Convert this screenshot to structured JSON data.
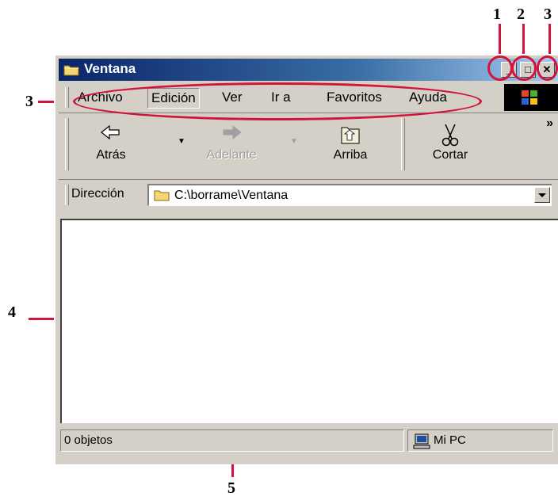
{
  "annotations": {
    "top_numbers": [
      "1",
      "2",
      "3"
    ],
    "menu_number": "3",
    "content_number": "4",
    "status_number": "5"
  },
  "window": {
    "title": "Ventana",
    "controls": {
      "minimize": "_",
      "maximize": "□",
      "close": "✕"
    }
  },
  "menubar": {
    "items": [
      "Archivo",
      "Edición",
      "Ver",
      "Ir a",
      "Favoritos",
      "Ayuda"
    ],
    "selected": "Edición"
  },
  "toolbar": {
    "back": "Atrás",
    "forward": "Adelante",
    "up": "Arriba",
    "cut": "Cortar",
    "overflow": "»"
  },
  "address": {
    "label": "Dirección",
    "value": "C:\\borrame\\Ventana"
  },
  "status": {
    "objects": "0 objetos",
    "location": "Mi PC"
  },
  "colors": {
    "annotation": "#d0143c",
    "titlebar_start": "#0a246a",
    "titlebar_end": "#a6caf0",
    "face": "#d4d0c8"
  }
}
